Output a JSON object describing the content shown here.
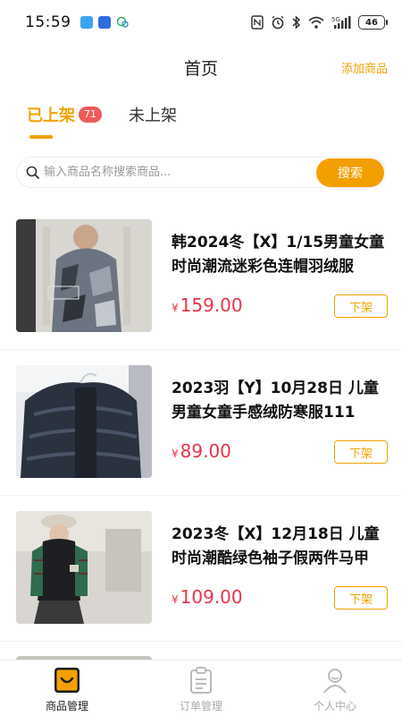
{
  "status_bar": {
    "time": "15:59",
    "battery": "46"
  },
  "header": {
    "title": "首页",
    "add_product": "添加商品"
  },
  "tabs": [
    {
      "label": "已上架",
      "count": "71"
    },
    {
      "label": "未上架"
    }
  ],
  "search": {
    "placeholder": "输入商品名称搜索商品...",
    "button": "搜索"
  },
  "products": [
    {
      "name": "韩2024冬【X】1/15男童女童时尚潮流迷彩色连帽羽绒服",
      "currency": "¥",
      "price": "159.00",
      "action": "下架"
    },
    {
      "name": "2023羽【Y】10月28日 儿童男童女童手感绒防寒服111",
      "currency": "¥",
      "price": "89.00",
      "action": "下架"
    },
    {
      "name": "2023冬【X】12月18日 儿童时尚潮酷绿色袖子假两件马甲",
      "currency": "¥",
      "price": "109.00",
      "action": "下架"
    }
  ],
  "bottom_nav": [
    {
      "label": "商品管理",
      "icon": "store-bag-icon"
    },
    {
      "label": "订单管理",
      "icon": "clipboard-icon"
    },
    {
      "label": "个人中心",
      "icon": "user-icon"
    }
  ],
  "colors": {
    "accent": "#f2a100",
    "price": "#e8344a",
    "badge": "#f05a5a"
  }
}
